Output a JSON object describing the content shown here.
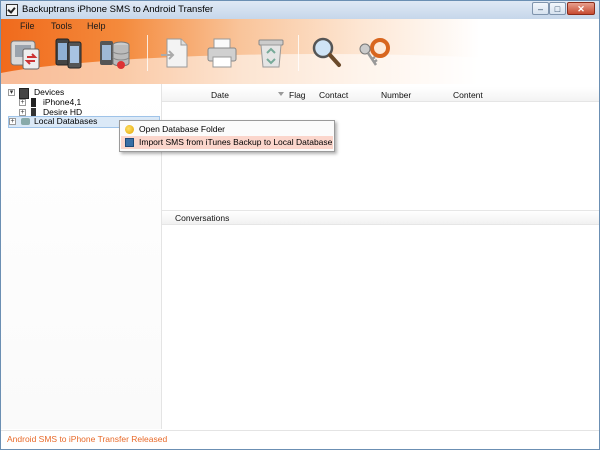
{
  "window": {
    "title": "Backuptrans iPhone SMS to Android Transfer",
    "controls": {
      "minimize": "–",
      "maximize": "□",
      "close": "✕"
    }
  },
  "menu": [
    "File",
    "Tools",
    "Help"
  ],
  "toolbar": {
    "buttons": [
      {
        "icon": "transfer-device-icon"
      },
      {
        "icon": "phones-icon"
      },
      {
        "icon": "device-database-icon"
      },
      {
        "icon": "export-document-icon"
      },
      {
        "icon": "printer-icon"
      },
      {
        "icon": "recycle-bin-icon"
      },
      {
        "icon": "magnifier-icon"
      },
      {
        "icon": "keys-icon"
      }
    ]
  },
  "tree": {
    "devices_label": "Devices",
    "devices": [
      "iPhone4,1",
      "Desire HD"
    ],
    "local_db_label": "Local Databases"
  },
  "messages_table": {
    "columns": [
      "Date",
      "Flag",
      "Contact",
      "Number",
      "Content"
    ]
  },
  "conversations": {
    "label": "Conversations"
  },
  "context_menu": {
    "items": [
      "Open Database Folder",
      "Import SMS from iTunes Backup to Local Database"
    ],
    "highlighted_index": 1
  },
  "status": {
    "text": "Android SMS to iPhone Transfer Released"
  },
  "colors": {
    "accent_orange": "#f06a1c",
    "status_text": "#e86a2a",
    "menu_highlight": "#fbd6cc",
    "selection": "#dbe9f7"
  }
}
